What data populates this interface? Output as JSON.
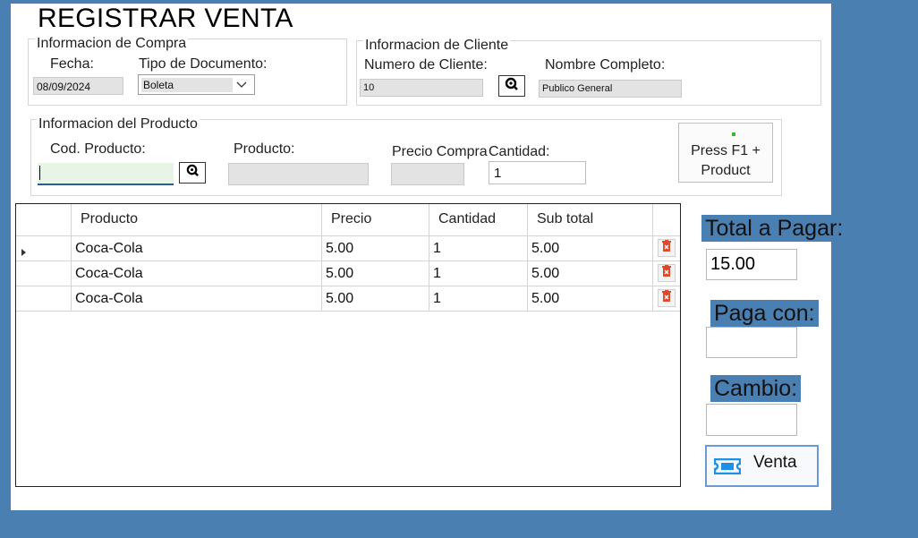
{
  "window": {
    "title": "REGISTRAR VENTA"
  },
  "compra": {
    "legend": "Informacion de Compra",
    "fecha_label": "Fecha:",
    "fecha_value": "08/09/2024",
    "tipo_label": "Tipo de Documento:",
    "tipo_value": "Boleta"
  },
  "cliente": {
    "legend": "Informacion de Cliente",
    "numero_label": "Numero de Cliente:",
    "numero_value": "10",
    "nombre_label": "Nombre Completo:",
    "nombre_value": "Publico General"
  },
  "producto": {
    "legend": "Informacion del Producto",
    "cod_label": "Cod. Producto:",
    "cod_value": "",
    "producto_label": "Producto:",
    "producto_value": "",
    "precio_label": "Precio Compra",
    "precio_value": "",
    "cantidad_label": "Cantidad:",
    "cantidad_value": "1",
    "hint_line1": "Press F1 +",
    "hint_line2": "Product"
  },
  "table": {
    "columns": [
      "Producto",
      "Precio",
      "Cantidad",
      "Sub total"
    ],
    "rows": [
      {
        "producto": "Coca-Cola",
        "precio": "5.00",
        "cantidad": "1",
        "subtotal": "5.00"
      },
      {
        "producto": "Coca-Cola",
        "precio": "5.00",
        "cantidad": "1",
        "subtotal": "5.00"
      },
      {
        "producto": "Coca-Cola",
        "precio": "5.00",
        "cantidad": "1",
        "subtotal": "5.00"
      }
    ]
  },
  "totals": {
    "total_label": "Total a Pagar:",
    "total_value": "15.00",
    "paga_label": "Paga con:",
    "paga_value": "",
    "cambio_label": "Cambio:",
    "cambio_value": "",
    "venta_button": "Venta"
  },
  "colors": {
    "background": "#4a7fb2",
    "delete_icon": "#e0482a",
    "venta_icon": "#1e90e6"
  },
  "icons": {
    "search": "search-icon",
    "delete": "trash-icon",
    "venta": "ticket-icon"
  }
}
